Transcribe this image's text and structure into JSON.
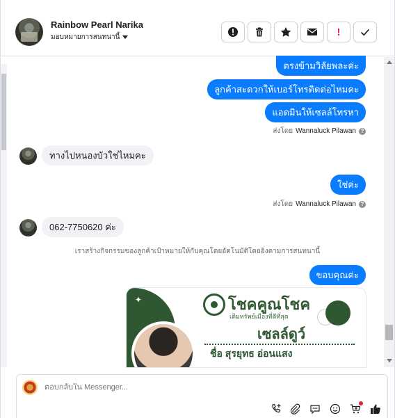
{
  "header": {
    "contact_name": "Rainbow Pearl Narika",
    "assign_label": "มอบหมายการสนทนานี้",
    "actions": [
      {
        "name": "spam-icon"
      },
      {
        "name": "trash-icon"
      },
      {
        "name": "star-icon"
      },
      {
        "name": "mail-icon"
      },
      {
        "name": "exclamation-icon",
        "label": "!"
      },
      {
        "name": "check-icon"
      }
    ]
  },
  "messages": {
    "out1": "ตรงข้ามวิลัยพละค่ะ",
    "out2": "ลูกค้าสะดวกให้เบอร์โทรติดต่อไหมคะ",
    "out3": "แอดมินให้เซลล์โทรหา",
    "sent_by_prefix": "ส่งโดย",
    "sent_by_name": "Wannaluck Pilawan",
    "help_glyph": "?",
    "in1": "ทางไปหนองบัวใช่ไหมคะ",
    "out4": "ใช่ค่ะ",
    "in2": "062-7750620 ค่ะ",
    "system_note": "เราสร้างกิจกรรมของลูกค้าเป้าหมายให้กับคุณโดยอัตโนมัติโดยอิงตามการสนทนานี้",
    "out5": "ขอบคุณค่ะ"
  },
  "card": {
    "brand": "โชคคูณโชค",
    "brand_sub": "เติมทรัพย์เมืองที่ดีที่สุด",
    "title": "เซลล์ดูว์",
    "person": "ชื่อ สุรยุทธ  อ่อนแสง",
    "star_glyph": "✦"
  },
  "composer": {
    "placeholder": "ตอบกลับใน Messenger..."
  },
  "colors": {
    "accent": "#0a7cff",
    "brand_green": "#2f5732",
    "danger": "#e41e3f"
  }
}
